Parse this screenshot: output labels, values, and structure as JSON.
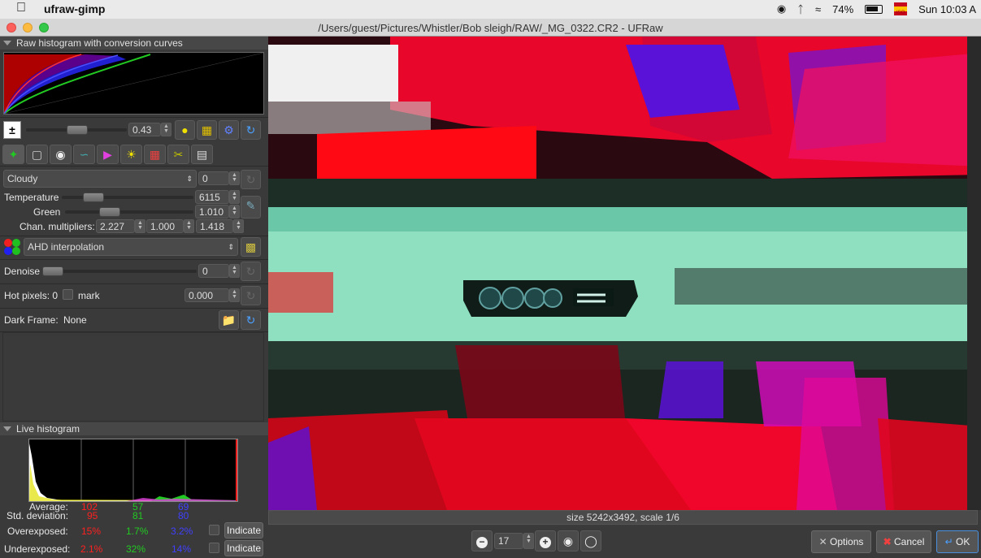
{
  "menubar": {
    "app": "ufraw-gimp",
    "battery": "74%",
    "clock": "Sun 10:03 A",
    "lang_badge": "ISO"
  },
  "window": {
    "title": "/Users/guest/Pictures/Whistler/Bob sleigh/RAW/_MG_0322.CR2 - UFRaw"
  },
  "raw_histogram": {
    "header": "Raw histogram with conversion curves"
  },
  "exposure": {
    "value": "0.43"
  },
  "white_balance": {
    "preset": "Cloudy",
    "fine_tune": "0",
    "temperature_label": "Temperature",
    "temperature": "6115",
    "green_label": "Green",
    "green": "1.010",
    "chan_label": "Chan. multipliers:",
    "chan": [
      "2.227",
      "1.000",
      "1.418"
    ]
  },
  "interpolation": {
    "value": "AHD interpolation"
  },
  "denoise": {
    "label": "Denoise",
    "value": "0"
  },
  "hot_pixels": {
    "label": "Hot pixels: 0",
    "mark_label": "mark",
    "value": "0.000"
  },
  "dark_frame": {
    "label": "Dark Frame:",
    "value": "None"
  },
  "live_histogram": {
    "header": "Live histogram",
    "average_label": "Average:",
    "average": [
      "102",
      "57",
      "69"
    ],
    "std_label": "Std. deviation:",
    "std": [
      "95",
      "81",
      "80"
    ],
    "over_label": "Overexposed:",
    "over": [
      "15%",
      "1.7%",
      "3.2%"
    ],
    "under_label": "Underexposed:",
    "under": [
      "2.1%",
      "32%",
      "14%"
    ],
    "indicate_label": "Indicate"
  },
  "status": {
    "text": "size 5242x3492, scale 1/6"
  },
  "zoom": {
    "value": "17"
  },
  "buttons": {
    "options": "Options",
    "cancel": "Cancel",
    "ok": "OK"
  },
  "colors": {
    "red": "#ff2020",
    "green": "#22c922",
    "blue": "#4040ff",
    "bg": "#3a3a3a"
  }
}
